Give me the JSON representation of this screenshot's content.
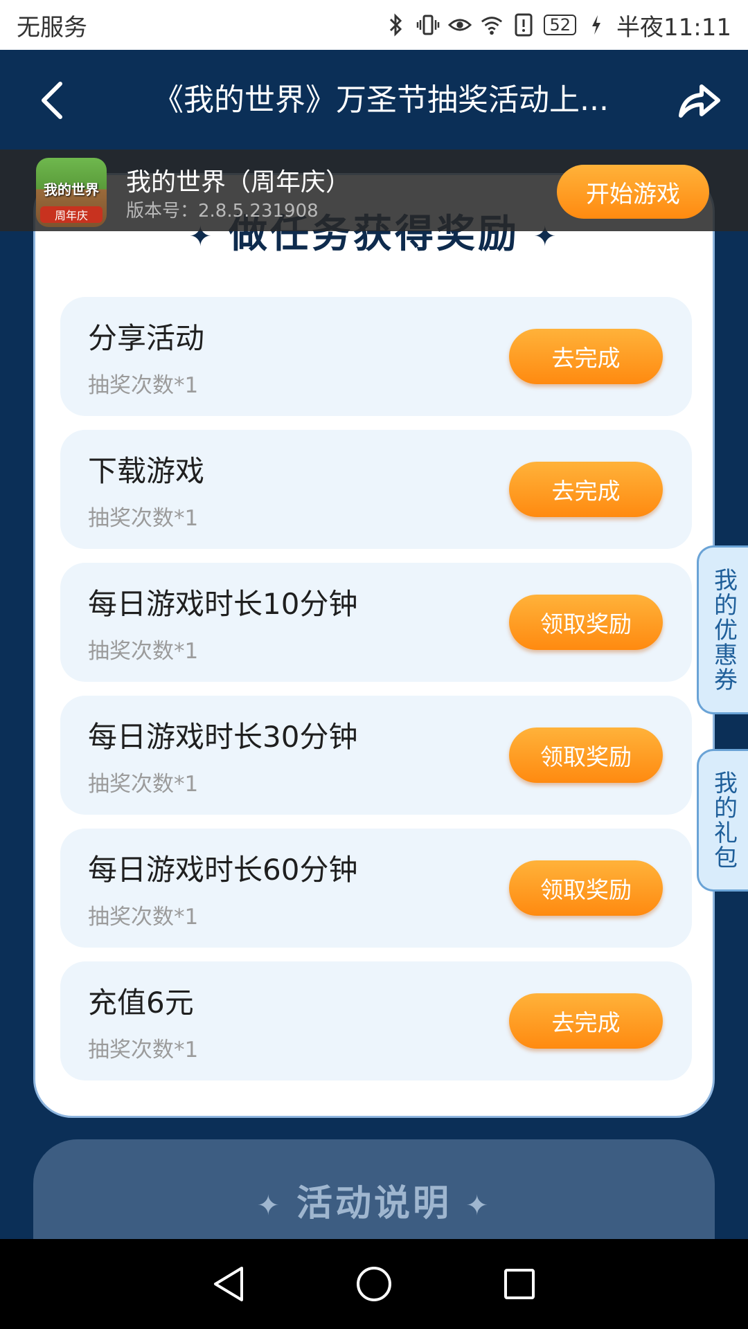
{
  "status_bar": {
    "carrier": "无服务",
    "battery": "52",
    "time": "半夜11:11"
  },
  "header": {
    "title": "《我的世界》万圣节抽奖活动上..."
  },
  "app_banner": {
    "name": "我的世界（周年庆）",
    "version": "版本号：2.8.5.231908",
    "start_label": "开始游戏",
    "icon_text": "我的世界",
    "icon_sub": "周年庆"
  },
  "tasks_section": {
    "title": "做任务获得奖励",
    "items": [
      {
        "name": "分享活动",
        "sub": "抽奖次数*1",
        "button": "去完成"
      },
      {
        "name": "下载游戏",
        "sub": "抽奖次数*1",
        "button": "去完成"
      },
      {
        "name": "每日游戏时长10分钟",
        "sub": "抽奖次数*1",
        "button": "领取奖励"
      },
      {
        "name": "每日游戏时长30分钟",
        "sub": "抽奖次数*1",
        "button": "领取奖励"
      },
      {
        "name": "每日游戏时长60分钟",
        "sub": "抽奖次数*1",
        "button": "领取奖励"
      },
      {
        "name": "充值6元",
        "sub": "抽奖次数*1",
        "button": "去完成"
      }
    ]
  },
  "side_tabs": {
    "coupons": "我的优惠券",
    "gifts": "我的礼包"
  },
  "activity_section": {
    "title": "活动说明"
  },
  "colors": {
    "page_bg": "#0b2f57",
    "accent_orange": "#ff9a1f",
    "card_item_bg": "#edf5fc"
  }
}
